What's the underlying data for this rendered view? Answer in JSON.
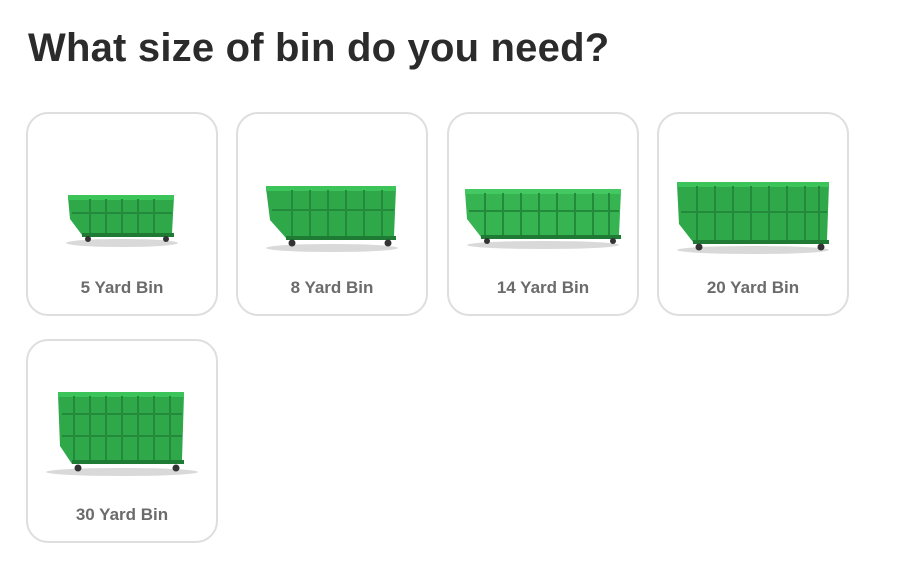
{
  "page": {
    "title": "What size of bin do you need?"
  },
  "bins": [
    {
      "label": "5 Yard Bin"
    },
    {
      "label": "8 Yard Bin"
    },
    {
      "label": "14 Yard Bin"
    },
    {
      "label": "20 Yard Bin"
    },
    {
      "label": "30 Yard Bin"
    }
  ],
  "colors": {
    "bin_green": "#2fa84a",
    "bin_green_light": "#3cc45a",
    "card_border": "#dedede",
    "label_text": "#6b6b6b"
  }
}
